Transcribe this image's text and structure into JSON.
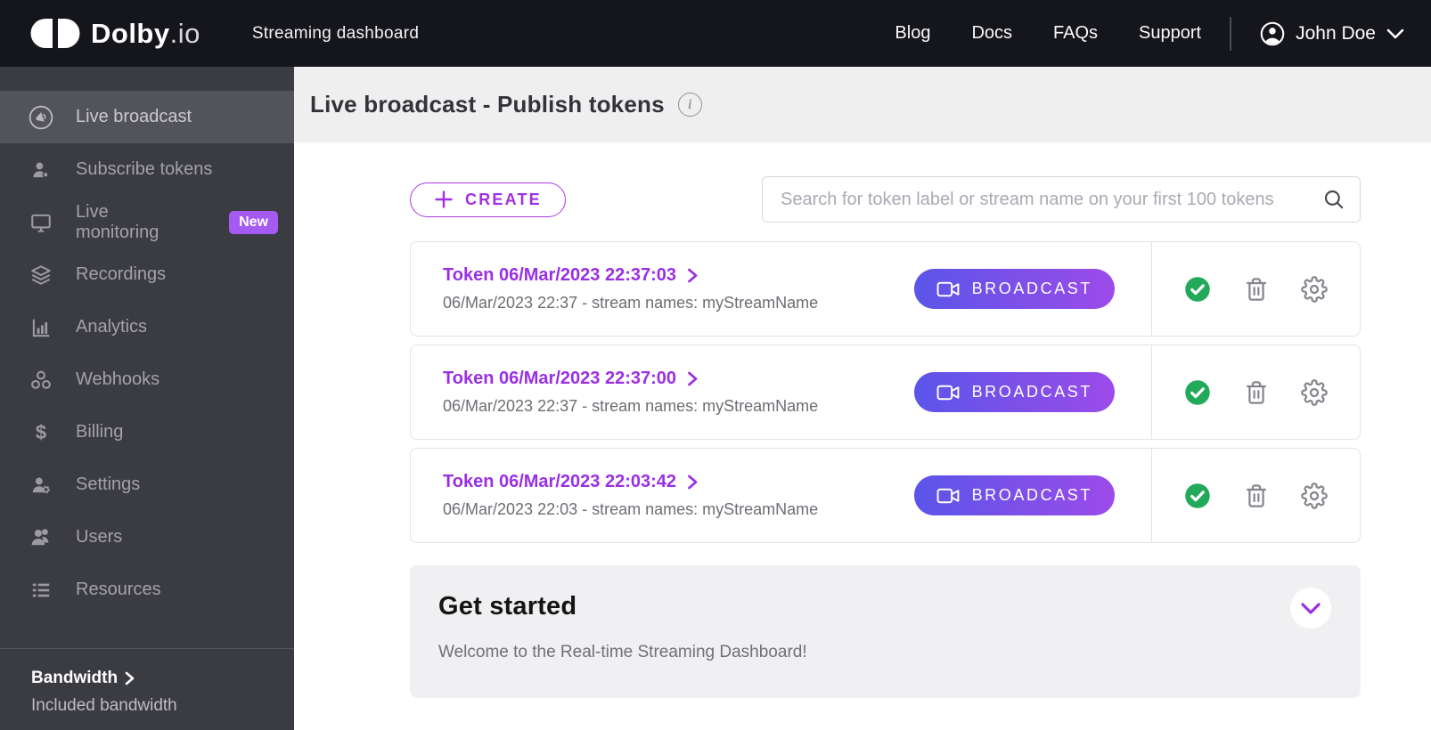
{
  "navbar": {
    "brand_bold": "Dolby",
    "brand_light": ".io",
    "subtitle": "Streaming dashboard",
    "links": [
      "Blog",
      "Docs",
      "FAQs",
      "Support"
    ],
    "user_name": "John Doe"
  },
  "sidebar": {
    "items": [
      {
        "label": "Live broadcast",
        "icon": "megaphone-icon",
        "active": true
      },
      {
        "label": "Subscribe tokens",
        "icon": "person-badge-icon",
        "active": false
      },
      {
        "label": "Live monitoring",
        "icon": "monitor-icon",
        "active": false,
        "badge": "New"
      },
      {
        "label": "Recordings",
        "icon": "layers-icon",
        "active": false
      },
      {
        "label": "Analytics",
        "icon": "bar-chart-icon",
        "active": false
      },
      {
        "label": "Webhooks",
        "icon": "webhooks-icon",
        "active": false
      },
      {
        "label": "Billing",
        "icon": "dollar-icon",
        "active": false
      },
      {
        "label": "Settings",
        "icon": "person-gear-icon",
        "active": false
      },
      {
        "label": "Users",
        "icon": "users-icon",
        "active": false
      },
      {
        "label": "Resources",
        "icon": "list-icon",
        "active": false
      }
    ],
    "footer": {
      "title": "Bandwidth",
      "subtitle": "Included bandwidth"
    }
  },
  "header": {
    "title": "Live broadcast - Publish tokens"
  },
  "toolbar": {
    "create_label": "CREATE",
    "search_placeholder": "Search for token label or stream name on your first 100 tokens"
  },
  "tokens": [
    {
      "name": "Token 06/Mar/2023 22:37:03",
      "details": "06/Mar/2023 22:37 - stream names: myStreamName",
      "action": "BROADCAST"
    },
    {
      "name": "Token 06/Mar/2023 22:37:00",
      "details": "06/Mar/2023 22:37 - stream names: myStreamName",
      "action": "BROADCAST"
    },
    {
      "name": "Token 06/Mar/2023 22:03:42",
      "details": "06/Mar/2023 22:03 - stream names: myStreamName",
      "action": "BROADCAST"
    }
  ],
  "get_started": {
    "title": "Get started",
    "message": "Welcome to the Real-time Streaming Dashboard!"
  },
  "colors": {
    "accent_purple": "#9b2fe3",
    "broadcast_gradient_start": "#5b55e9",
    "broadcast_gradient_end": "#9c4be9",
    "badge_purple": "#a55af2",
    "success_green": "#23a95a",
    "topbar_bg": "#15151c",
    "sidebar_bg": "#3b3b42",
    "sidebar_active_bg": "#53535b",
    "header_strip_bg": "#efeff0"
  }
}
